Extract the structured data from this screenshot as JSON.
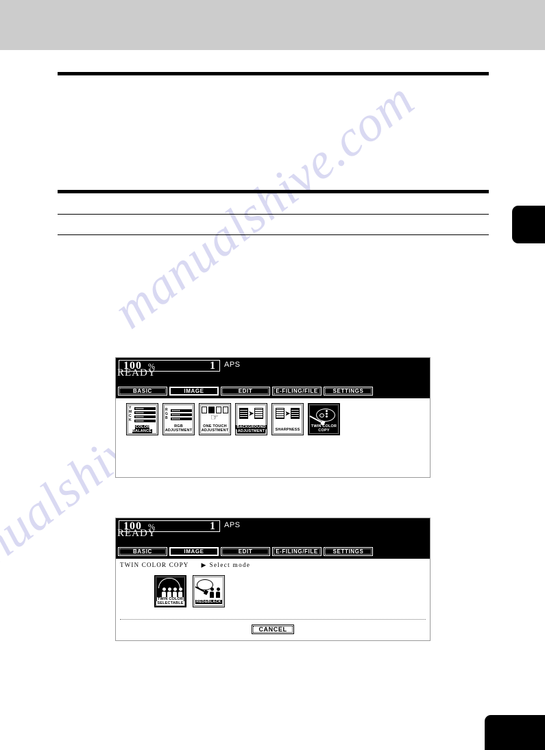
{
  "page": {
    "background_color": "#ffffff",
    "header_band_color": "#cccccc",
    "watermark_text": "manualshive.com"
  },
  "panels": [
    {
      "id": "panel-image-tab",
      "lcd": {
        "zoom_value": "100",
        "zoom_unit": "%",
        "copies": "1",
        "paper_mode": "APS",
        "status": "READY"
      },
      "tabs": [
        {
          "label": "BASIC",
          "selected": false
        },
        {
          "label": "IMAGE",
          "selected": true
        },
        {
          "label": "EDIT",
          "selected": false
        },
        {
          "label": "E-FILING/FILE",
          "selected": false
        },
        {
          "label": "SETTINGS",
          "selected": false
        }
      ],
      "breadcrumb": null,
      "buttons": [
        {
          "name": "color-balance",
          "caption_lines": [
            "COLOR BALANCE"
          ],
          "art": "sliders-ymck",
          "sliders": [
            "Y",
            "M",
            "C",
            "K"
          ],
          "selected": false
        },
        {
          "name": "rgb-adjustment",
          "caption_lines": [
            "RGB",
            "ADJUSTMENT"
          ],
          "art": "sliders-rgb",
          "sliders": [
            "R",
            "G",
            "B"
          ],
          "selected": false
        },
        {
          "name": "one-touch-adjustment",
          "caption_lines": [
            "ONE TOUCH",
            "ADJUSTMENT"
          ],
          "art": "one-touch-boxes",
          "selected": false
        },
        {
          "name": "background-adjustment",
          "caption_lines": [
            "BACKGROUND",
            "ADJUSTMENT"
          ],
          "art": "page-to-page",
          "selected": false
        },
        {
          "name": "sharpness",
          "caption_lines": [
            "SHARPNESS"
          ],
          "art": "page-to-page",
          "selected": false
        },
        {
          "name": "twin-color-copy",
          "caption_lines": [
            "TWIN COLOR",
            "COPY"
          ],
          "art": "palette",
          "selected": true
        }
      ],
      "cancel_label": null
    },
    {
      "id": "panel-twin-color-select-mode",
      "lcd": {
        "zoom_value": "100",
        "zoom_unit": "%",
        "copies": "1",
        "paper_mode": "APS",
        "status": "READY"
      },
      "tabs": [
        {
          "label": "BASIC",
          "selected": false
        },
        {
          "label": "IMAGE",
          "selected": true
        },
        {
          "label": "EDIT",
          "selected": false
        },
        {
          "label": "E-FILING/FILE",
          "selected": false
        },
        {
          "label": "SETTINGS",
          "selected": false
        }
      ],
      "breadcrumb": {
        "title": "TWIN COLOR COPY",
        "arrow": "▶",
        "sub": "Select mode"
      },
      "buttons": [
        {
          "name": "twin-color-selectable",
          "caption_lines": [
            "TWIN COLOR",
            "SELECTABLE"
          ],
          "art": "people-palette",
          "selected": true
        },
        {
          "name": "red-and-black",
          "caption_lines": [
            "RED&BLACK"
          ],
          "art": "palette-people",
          "selected": false
        }
      ],
      "cancel_label": "CANCEL"
    }
  ]
}
